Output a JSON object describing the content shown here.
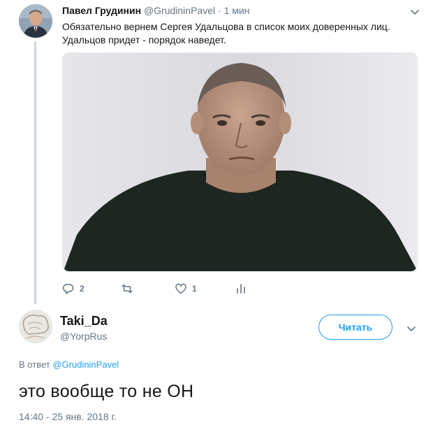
{
  "tweet1": {
    "author_name": "Павел Грудинин",
    "author_handle": "@GrudininPavel",
    "separator": "·",
    "time": "1 мин",
    "text_line1": "Обязательно вернем Сергея Удальцова в список моих доверенных лиц.",
    "text_line2": "Удальцов придет - порядок наведет.",
    "media_icon": "photo-of-man-in-dark-sweater",
    "actions": {
      "reply_count": "2",
      "retweet_count": "",
      "like_count": "1"
    }
  },
  "tweet2": {
    "author_name": "Taki_Da",
    "author_handle": "@YorpRus",
    "follow_label": "Читать",
    "reply_prefix": "В ответ",
    "reply_mention": "@GrudininPavel",
    "text": "это вообще то не ОН",
    "timestamp": "14:40 - 25 янв. 2018 г."
  },
  "colors": {
    "accent": "#1da1f2",
    "secondary_text": "#657786",
    "primary_text": "#14171a",
    "thread_line": "#ccd6dd"
  }
}
